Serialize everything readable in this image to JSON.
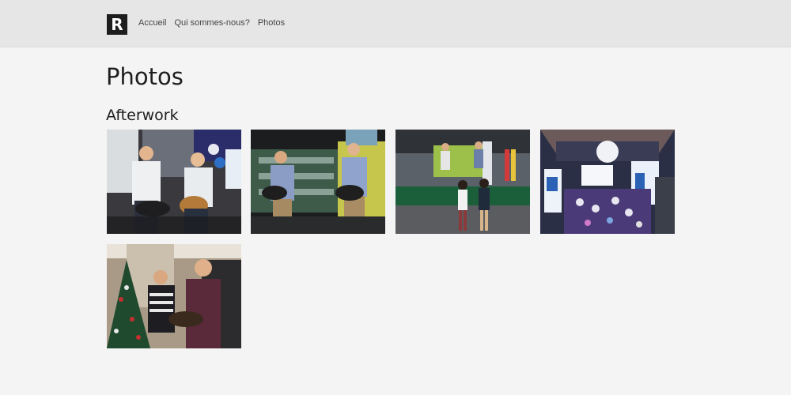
{
  "nav": {
    "logo_letter": "R",
    "links": [
      "Accueil",
      "Qui sommes-nous?",
      "Photos"
    ]
  },
  "page": {
    "title": "Photos"
  },
  "gallery": {
    "section_title": "Afterwork",
    "photos": [
      {
        "subject": "two guitarists performing"
      },
      {
        "subject": "duo playing guitars near kegs"
      },
      {
        "subject": "stage with audience"
      },
      {
        "subject": "event hall crowd"
      },
      {
        "subject": "musicians by christmas tree"
      }
    ]
  }
}
